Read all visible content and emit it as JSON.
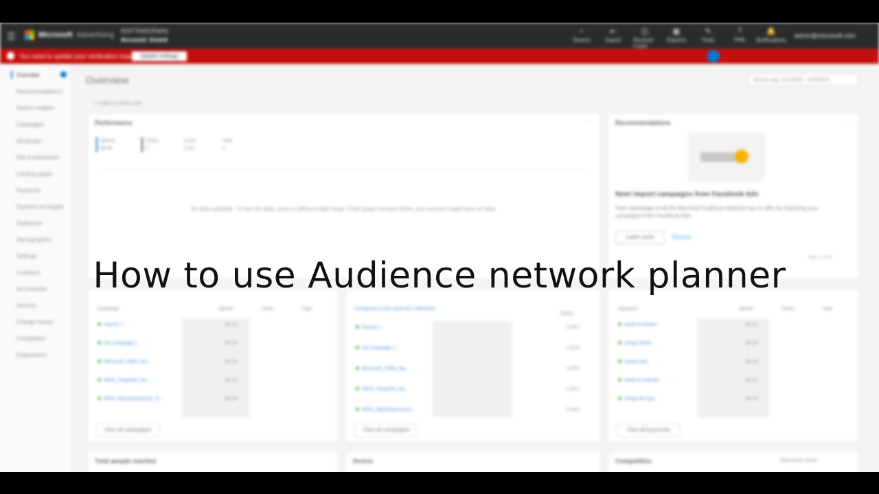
{
  "overlay": {
    "title": "How to use Audience network planner"
  },
  "topbar": {
    "brand": "Microsoft",
    "product": "Advertising",
    "account_line1": "MSFTAdID/DaNo",
    "account_line2": "Account: Invent",
    "tools": [
      {
        "label": "Search",
        "icon": "⌕"
      },
      {
        "label": "Import",
        "icon": "⇤"
      },
      {
        "label": "Revised Colds",
        "icon": "◫"
      },
      {
        "label": "Reports",
        "icon": "▦"
      },
      {
        "label": "Tools",
        "icon": "✎"
      },
      {
        "label": "Help",
        "icon": "?"
      },
      {
        "label": "Notifications",
        "icon": "🔔"
      }
    ],
    "user": "admin@microsoft.com"
  },
  "alert": {
    "text": "You need to update your verification request",
    "button": "Update settings"
  },
  "sidebar": {
    "items": [
      "Overview",
      "Recommendations",
      "Search insights",
      "Campaigns",
      "Ad groups",
      "Ads & extensions",
      "Landing pages",
      "Keywords",
      "Dynamic ad targets",
      "Audiences",
      "Demographics",
      "Settings",
      "Locations",
      "Ad schedule",
      "Devices",
      "Change history",
      "Competition",
      "Experiments"
    ]
  },
  "main": {
    "title": "Overview",
    "date_range": "Month day, 4/1/2023 - 4/3/2023",
    "add_tile": "Add a custom tile",
    "performance": {
      "title": "Performance",
      "metrics": [
        {
          "label": "Spend",
          "value": "$0.00"
        },
        {
          "label": "Clicks",
          "value": "0"
        },
        {
          "label": "Conv.",
          "value": "0.00"
        },
        {
          "label": "Impr.",
          "value": "0"
        }
      ],
      "no_data": "No data available. To see the data, select a different date range. If this graph remains blank, your account might have no data."
    },
    "recommendations": {
      "title": "Recommendations",
      "headline": "New! Import campaigns from Facebook Ads",
      "description": "Take advantage of all the Microsoft Audience Network has to offer by importing your campaigns from Facebook Ads.",
      "learn_more": "Learn more",
      "dismiss": "Dismiss",
      "paging": "Next 1 of 8"
    },
    "campaigns_card": {
      "col1": "Campaign",
      "col2": "Spend",
      "col3": "Clicks",
      "col4": "Impr.",
      "rows": [
        "Search 1",
        "AN Campaign 1",
        "Microsoft_Video_Na...",
        "NEW_TargetAN_Na...",
        "NEW_NaturExpressive_N..."
      ],
      "spend": [
        "$0.00",
        "$0.00",
        "$0.00",
        "$0.00",
        "$0.00"
      ],
      "view_all": "View all campaigns"
    },
    "compare_card": {
      "title": "Compared to last week (3/1-3/8/2023)",
      "col": "Clicks",
      "rows": [
        "Search 1",
        "AN Campaign 1",
        "Microsoft_Video_Na...",
        "NEW_TargetAN_Na...",
        "NEW_NaturExpressive..."
      ],
      "vals": [
        "0.00%",
        "0.00%",
        "0.00%",
        "0.00%",
        "0.00%"
      ],
      "view_all": "View all campaigns"
    },
    "keywords_card": {
      "col1": "Keyword",
      "col2": "Spend",
      "col3": "Clicks",
      "col4": "Impr.",
      "rows": [
        "travel to london",
        "cheap hotels",
        "cheap trips",
        "travel to orlando",
        "cheap ski trips"
      ],
      "spend": [
        "$0.00",
        "$0.00",
        "$0.00",
        "$0.00",
        "$0.00"
      ],
      "view_all": "View all keywords"
    },
    "bottom_cards": [
      "Total people reached",
      "Device",
      "Competition"
    ],
    "competition_filter": "Impression share"
  }
}
